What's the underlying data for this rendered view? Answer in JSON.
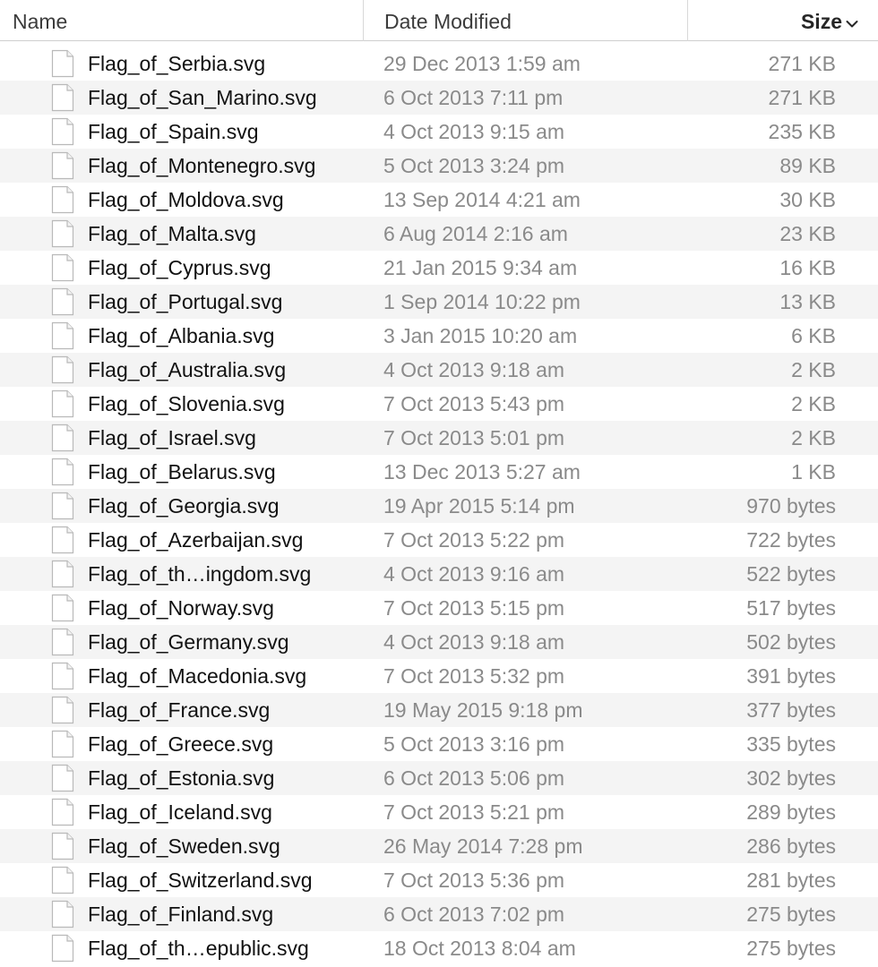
{
  "columns": {
    "name": "Name",
    "date": "Date Modified",
    "size": "Size",
    "sort_icon": "chevron-down-icon"
  },
  "colors": {
    "stripe": "#f4f4f4",
    "name_text": "#111111",
    "meta_text": "#8a8a8a"
  },
  "files": [
    {
      "name": "Flag_of_Serbia.svg",
      "date": "29 Dec 2013 1:59 am",
      "size": "271 KB"
    },
    {
      "name": "Flag_of_San_Marino.svg",
      "date": "6 Oct 2013 7:11 pm",
      "size": "271 KB"
    },
    {
      "name": "Flag_of_Spain.svg",
      "date": "4 Oct 2013 9:15 am",
      "size": "235 KB"
    },
    {
      "name": "Flag_of_Montenegro.svg",
      "date": "5 Oct 2013 3:24 pm",
      "size": "89 KB"
    },
    {
      "name": "Flag_of_Moldova.svg",
      "date": "13 Sep 2014 4:21 am",
      "size": "30 KB"
    },
    {
      "name": "Flag_of_Malta.svg",
      "date": "6 Aug 2014 2:16 am",
      "size": "23 KB"
    },
    {
      "name": "Flag_of_Cyprus.svg",
      "date": "21 Jan 2015 9:34 am",
      "size": "16 KB"
    },
    {
      "name": "Flag_of_Portugal.svg",
      "date": "1 Sep 2014 10:22 pm",
      "size": "13 KB"
    },
    {
      "name": "Flag_of_Albania.svg",
      "date": "3 Jan 2015 10:20 am",
      "size": "6 KB"
    },
    {
      "name": "Flag_of_Australia.svg",
      "date": "4 Oct 2013 9:18 am",
      "size": "2 KB"
    },
    {
      "name": "Flag_of_Slovenia.svg",
      "date": "7 Oct 2013 5:43 pm",
      "size": "2 KB"
    },
    {
      "name": "Flag_of_Israel.svg",
      "date": "7 Oct 2013 5:01 pm",
      "size": "2 KB"
    },
    {
      "name": "Flag_of_Belarus.svg",
      "date": "13 Dec 2013 5:27 am",
      "size": "1 KB"
    },
    {
      "name": "Flag_of_Georgia.svg",
      "date": "19 Apr 2015 5:14 pm",
      "size": "970 bytes"
    },
    {
      "name": "Flag_of_Azerbaijan.svg",
      "date": "7 Oct 2013 5:22 pm",
      "size": "722 bytes"
    },
    {
      "name": "Flag_of_th…ingdom.svg",
      "date": "4 Oct 2013 9:16 am",
      "size": "522 bytes"
    },
    {
      "name": "Flag_of_Norway.svg",
      "date": "7 Oct 2013 5:15 pm",
      "size": "517 bytes"
    },
    {
      "name": "Flag_of_Germany.svg",
      "date": "4 Oct 2013 9:18 am",
      "size": "502 bytes"
    },
    {
      "name": "Flag_of_Macedonia.svg",
      "date": "7 Oct 2013 5:32 pm",
      "size": "391 bytes"
    },
    {
      "name": "Flag_of_France.svg",
      "date": "19 May 2015 9:18 pm",
      "size": "377 bytes"
    },
    {
      "name": "Flag_of_Greece.svg",
      "date": "5 Oct 2013 3:16 pm",
      "size": "335 bytes"
    },
    {
      "name": "Flag_of_Estonia.svg",
      "date": "6 Oct 2013 5:06 pm",
      "size": "302 bytes"
    },
    {
      "name": "Flag_of_Iceland.svg",
      "date": "7 Oct 2013 5:21 pm",
      "size": "289 bytes"
    },
    {
      "name": "Flag_of_Sweden.svg",
      "date": "26 May 2014 7:28 pm",
      "size": "286 bytes"
    },
    {
      "name": "Flag_of_Switzerland.svg",
      "date": "7 Oct 2013 5:36 pm",
      "size": "281 bytes"
    },
    {
      "name": "Flag_of_Finland.svg",
      "date": "6 Oct 2013 7:02 pm",
      "size": "275 bytes"
    },
    {
      "name": "Flag_of_th…epublic.svg",
      "date": "18 Oct 2013 8:04 am",
      "size": "275 bytes"
    }
  ]
}
